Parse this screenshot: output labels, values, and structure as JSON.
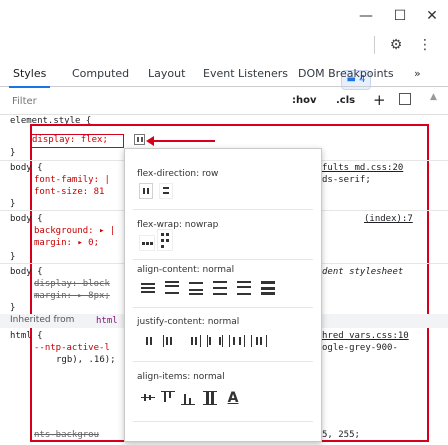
{
  "window": {
    "minimize": "—",
    "maximize": "☐",
    "close": "✕"
  },
  "toolbar": {
    "badge_count": "4",
    "settings_icon": "gear-icon",
    "more_icon": "vertical-dots-icon"
  },
  "tabs": [
    "Styles",
    "Computed",
    "Layout",
    "Event Listeners",
    "DOM Breakpoints",
    "»"
  ],
  "filter": {
    "placeholder": "Filter",
    "hov": ":hov",
    "cls": ".cls",
    "plus": "+"
  },
  "rules": {
    "element_style": "element.style {",
    "display_line": "display: flex;",
    "close1": "}",
    "body1_sel": "body {",
    "body1_l1": "font-family: |",
    "body1_l2": "font-size: 81",
    "body1_src": "fults md.css:20",
    "body1_src2": "ds-serif;",
    "close2": "}",
    "body2_sel": "body {",
    "body2_l1": "background: ▸ |",
    "body2_l2": "margin: ▸ 0;",
    "body2_src": "(index):7",
    "close3": "}",
    "body3_sel": "body {",
    "body3_l1": "display: block",
    "body3_l2": "margin: ▸ 8px;",
    "body3_src": "dent stylesheet",
    "close4": "}",
    "inherited": "Inherited from",
    "inherited_tag": "html",
    "html_sel": "html {",
    "html_l1": "--ntp-active-l",
    "html_l2": "rgb), .16);",
    "html_src": "hred vars.css:10",
    "html_src2": "ogle-grey-900-",
    "html_last": "nts-backgrou",
    "html_tail": "5, 255;"
  },
  "flex_editor": {
    "flex_direction": "flex-direction: row",
    "flex_wrap": "flex-wrap: nowrap",
    "align_content": "align-content: normal",
    "justify_content": "justify-content: normal",
    "align_items": "align-items: normal"
  },
  "colors": {
    "accent": "#1a73e8",
    "highlight": "#d6001c"
  }
}
